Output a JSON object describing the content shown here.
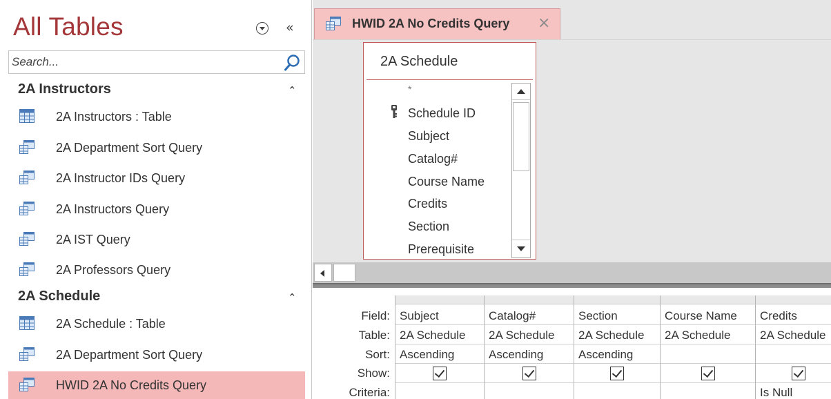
{
  "nav": {
    "title": "All Tables",
    "search_placeholder": "Search...",
    "groups": [
      {
        "name": "2A Instructors",
        "items": [
          {
            "label": "2A Instructors : Table",
            "icon": "table-icon"
          },
          {
            "label": "2A Department Sort Query",
            "icon": "query-icon"
          },
          {
            "label": "2A Instructor IDs Query",
            "icon": "query-icon"
          },
          {
            "label": "2A Instructors Query",
            "icon": "query-icon"
          },
          {
            "label": "2A IST Query",
            "icon": "query-icon"
          },
          {
            "label": "2A Professors Query",
            "icon": "query-icon"
          }
        ]
      },
      {
        "name": "2A Schedule",
        "items": [
          {
            "label": "2A Schedule : Table",
            "icon": "table-icon"
          },
          {
            "label": "2A Department Sort Query",
            "icon": "query-icon"
          },
          {
            "label": "HWID 2A No Credits Query",
            "icon": "query-icon",
            "selected": true
          }
        ]
      }
    ]
  },
  "document_tab": {
    "label": "HWID 2A No Credits Query"
  },
  "field_list": {
    "title": "2A Schedule",
    "fields": [
      "*",
      "Schedule ID",
      "Subject",
      "Catalog#",
      "Course Name",
      "Credits",
      "Section",
      "Prerequisite"
    ],
    "primary_key": "Schedule ID"
  },
  "qbe": {
    "row_labels": {
      "field": "Field:",
      "table": "Table:",
      "sort": "Sort:",
      "show": "Show:",
      "criteria": "Criteria:"
    },
    "columns": [
      {
        "field": "Subject",
        "table": "2A Schedule",
        "sort": "Ascending",
        "show": true,
        "criteria": ""
      },
      {
        "field": "Catalog#",
        "table": "2A Schedule",
        "sort": "Ascending",
        "show": true,
        "criteria": ""
      },
      {
        "field": "Section",
        "table": "2A Schedule",
        "sort": "Ascending",
        "show": true,
        "criteria": ""
      },
      {
        "field": "Course Name",
        "table": "2A Schedule",
        "sort": "",
        "show": true,
        "criteria": ""
      },
      {
        "field": "Credits",
        "table": "2A Schedule",
        "sort": "",
        "show": true,
        "criteria": "Is Null"
      }
    ]
  },
  "colors": {
    "accent": "#a4373a",
    "selection": "#f4b8b8",
    "tab": "#f6c2c2"
  }
}
